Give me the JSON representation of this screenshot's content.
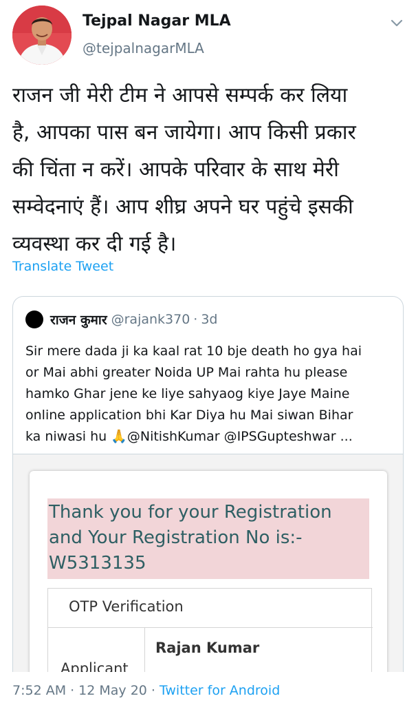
{
  "author": {
    "name": "Tejpal Nagar MLA",
    "handle": "@tejpalnagarMLA"
  },
  "tweet": {
    "lines": [
      "राजन जी मेरी टीम ने आपसे सम्पर्क कर लिया",
      "है, आपका पास बन जायेगा। आप किसी प्रकार",
      "की चिंता न करें। आपके परिवार के साथ मेरी",
      "सम्वेदनाएं हैं। आप शीघ्र अपने घर पहुंचे इसकी",
      "व्यवस्था कर दी गई है।"
    ],
    "translate_label": "Translate Tweet"
  },
  "quoted": {
    "name": "राजन कुमार",
    "handle": "@rajank370",
    "separator": "·",
    "time": "3d",
    "lines": [
      "Sir mere dada ji ka kaal rat 10 bje death ho gya hai",
      "or Mai abhi greater Noida UP  Mai rahta hu please",
      "hamko Ghar jene ke liye  sahyaog kiye Jaye Maine",
      "online application bhi Kar Diya hu Mai siwan Bihar",
      "ka niwasi hu 🙏@NitishKumar @IPSGupteshwar ..."
    ],
    "media": {
      "registration_lines": [
        "Thank you for your Registration",
        "and Your Registration No is:-",
        "W5313135"
      ],
      "otp_label": "OTP Verification",
      "applicant_name": "Rajan Kumar",
      "applicant_label": "Applicant"
    }
  },
  "footer": {
    "time": "7:52 AM",
    "separator": "·",
    "date": "12 May 20",
    "source": "Twitter for Android"
  },
  "colors": {
    "link": "#1da1f2",
    "muted": "#657786",
    "highlight_bg": "#f2d5d8",
    "highlight_text": "#2e5f63"
  },
  "icons": {
    "chevron": "chevron-down-icon",
    "folded_hands": "folded-hands-icon"
  }
}
